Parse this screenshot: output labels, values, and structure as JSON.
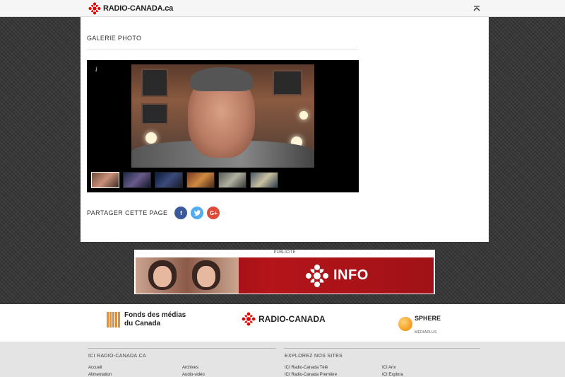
{
  "header": {
    "brand": "RADIO-CANADA.ca",
    "scroll_top_icon": "chevron-up-icon"
  },
  "gallery": {
    "title": "GALERIE PHOTO",
    "info_label": "i",
    "thumbnail_count": 6
  },
  "share": {
    "label": "PARTAGER CETTE PAGE",
    "buttons": [
      {
        "name": "facebook",
        "glyph": "f",
        "color": "#3b5998"
      },
      {
        "name": "twitter",
        "glyph": "t",
        "color": "#55acee"
      },
      {
        "name": "googleplus",
        "glyph": "G+",
        "color": "#dd4b39"
      }
    ]
  },
  "ad": {
    "label": "PUBLICITÉ",
    "text": "INFO"
  },
  "partners": {
    "fonds_line1": "Fonds des médias",
    "fonds_line2": "du Canada",
    "radio_canada": "RADIO-CANADA",
    "sphere": "SPHERE",
    "sphere_sub": "MEDIAPLUS"
  },
  "footer": {
    "col1_title": "ICI RADIO-CANADA.CA",
    "col1_links_a": [
      "Accueil",
      "Alimentation"
    ],
    "col1_links_b": [
      "Archives",
      "Audio-vidéo"
    ],
    "col2_title": "EXPLOREZ NOS SITES",
    "col2_links_a": [
      "ICI Radio-Canada Télé",
      "ICI Radio-Canada Première"
    ],
    "col2_links_b": [
      "ICI Artv",
      "ICI Explora"
    ]
  },
  "colors": {
    "brand_red": "#e60000",
    "page_bg": "#3a3a3a"
  }
}
